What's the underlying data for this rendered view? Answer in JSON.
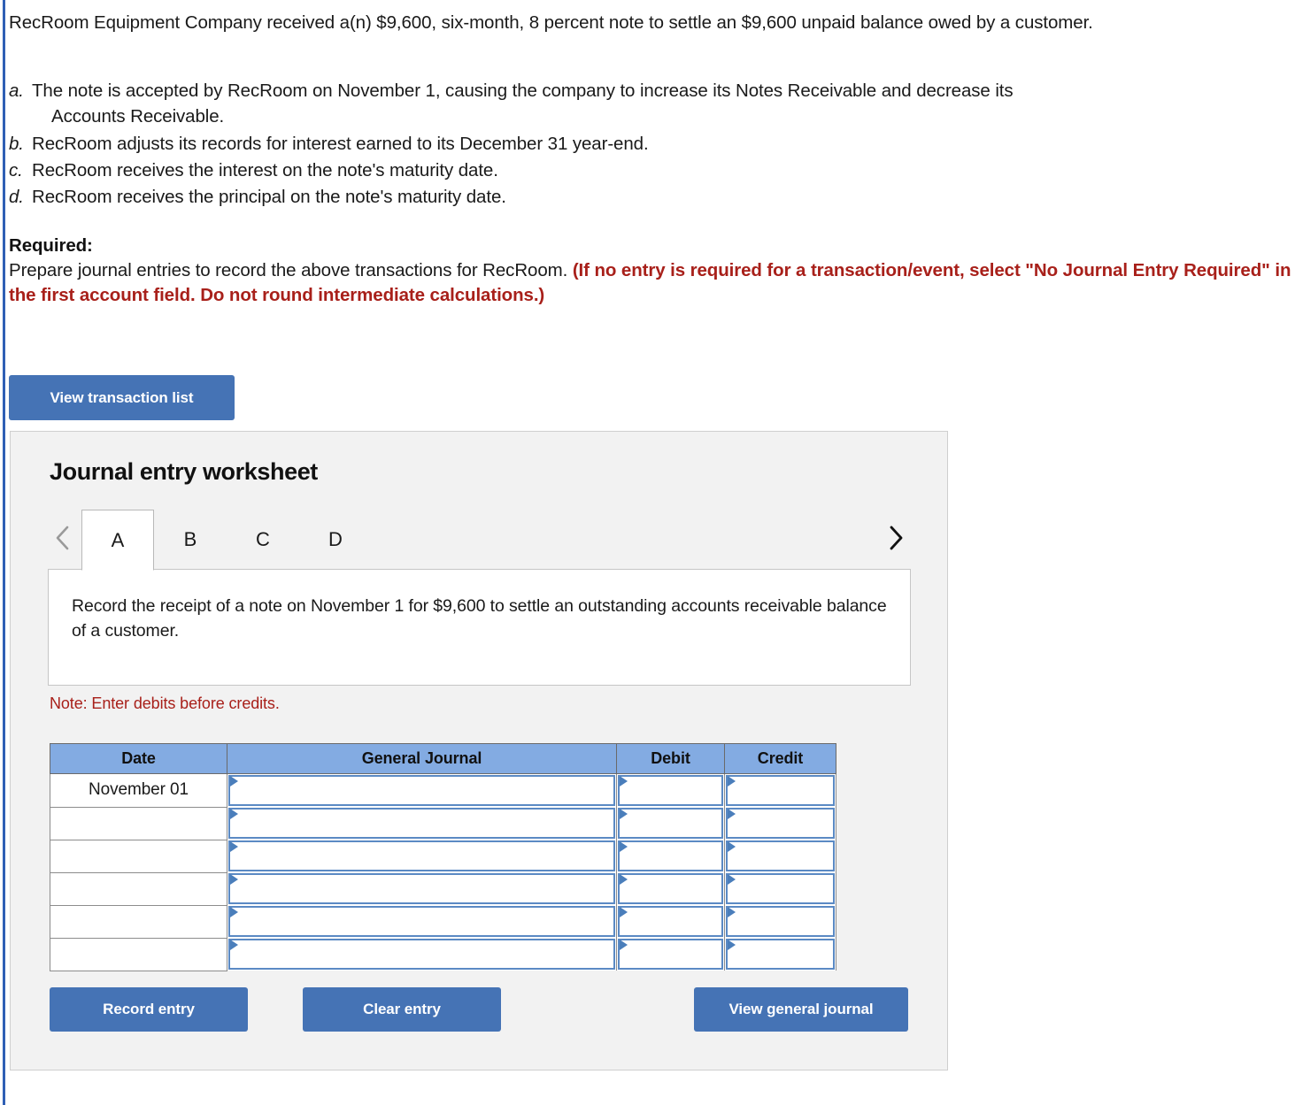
{
  "question": {
    "intro": "RecRoom Equipment Company received a(n) $9,600, six-month, 8 percent note to settle an $9,600 unpaid balance owed by a customer.",
    "items": [
      {
        "label": "a.",
        "line1": "The note is accepted by RecRoom on November 1, causing the company to increase its Notes Receivable and decrease its",
        "line2": "Accounts Receivable."
      },
      {
        "label": "b.",
        "line1": "RecRoom adjusts its records for interest earned to its December 31 year-end.",
        "line2": ""
      },
      {
        "label": "c.",
        "line1": "RecRoom receives the interest on the note's maturity date.",
        "line2": ""
      },
      {
        "label": "d.",
        "line1": "RecRoom receives the principal on the note's maturity date.",
        "line2": ""
      }
    ],
    "required_heading": "Required:",
    "required_text": "Prepare journal entries to record the above transactions for RecRoom. ",
    "required_emphasis": "(If no entry is required for a transaction/event, select \"No Journal Entry Required\" in the first account field. Do not round intermediate calculations.)"
  },
  "toolbar": {
    "view_transaction_list": "View transaction list"
  },
  "worksheet": {
    "title": "Journal entry worksheet",
    "nav": {
      "prev_icon": "chevron-left-icon",
      "next_icon": "chevron-right-icon"
    },
    "tabs": [
      {
        "label": "A",
        "active": true
      },
      {
        "label": "B",
        "active": false
      },
      {
        "label": "C",
        "active": false
      },
      {
        "label": "D",
        "active": false
      }
    ],
    "instruction": "Record the receipt of a note on November 1 for $9,600 to settle an outstanding accounts receivable balance of a customer.",
    "note": "Note: Enter debits before credits.",
    "table": {
      "columns": [
        "Date",
        "General Journal",
        "Debit",
        "Credit"
      ],
      "rows": [
        {
          "date": "November 01",
          "general_journal": "",
          "debit": "",
          "credit": ""
        },
        {
          "date": "",
          "general_journal": "",
          "debit": "",
          "credit": ""
        },
        {
          "date": "",
          "general_journal": "",
          "debit": "",
          "credit": ""
        },
        {
          "date": "",
          "general_journal": "",
          "debit": "",
          "credit": ""
        },
        {
          "date": "",
          "general_journal": "",
          "debit": "",
          "credit": ""
        },
        {
          "date": "",
          "general_journal": "",
          "debit": "",
          "credit": ""
        }
      ]
    },
    "buttons": {
      "record_entry": "Record entry",
      "clear_entry": "Clear entry",
      "view_general_journal": "View general journal"
    }
  },
  "colors": {
    "button_blue": "#4573b5",
    "table_header_blue": "#83abe2",
    "field_border_blue": "#5b8ac4",
    "red_emphasis": "#a8201a",
    "left_rule_blue": "#2f5fb5",
    "panel_gray": "#f2f2f2"
  }
}
